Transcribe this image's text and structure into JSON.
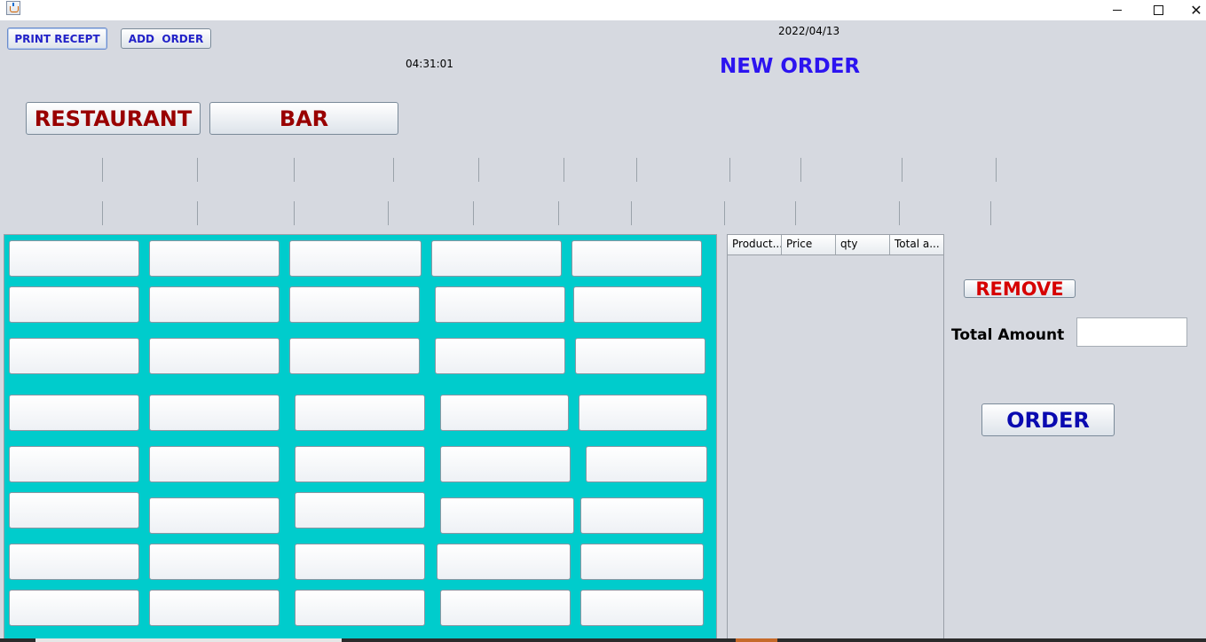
{
  "window": {
    "app_icon": "java-cup-icon",
    "controls": {
      "minimize": "—",
      "maximize": "☐",
      "close": "✕"
    }
  },
  "toolbar": {
    "print_receipt_label": "PRINT RECEPT",
    "add_order_label": "ADD  ORDER"
  },
  "header": {
    "date": "2022/04/13",
    "time": "04:31:01",
    "title": "NEW ORDER"
  },
  "categories": {
    "restaurant_label": "RESTAURANT",
    "bar_label": "BAR"
  },
  "colors": {
    "grid_background": "#00cccc",
    "title_color": "#2c14f0",
    "category_text": "#990000",
    "remove_text": "#d60000",
    "order_text": "#0a0ab0"
  },
  "order_table": {
    "columns": [
      "Product...",
      "Price",
      "qty",
      "Total a..."
    ],
    "rows": []
  },
  "actions": {
    "remove_label": "REMOVE",
    "total_amount_label": "Total Amount",
    "total_amount_value": "",
    "order_label": "ORDER"
  }
}
